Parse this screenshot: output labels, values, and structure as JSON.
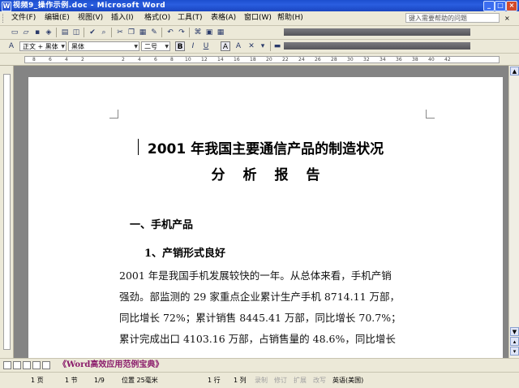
{
  "window": {
    "title": "视频9_操作示例.doc - Microsoft Word",
    "app_icon": "W"
  },
  "menu": {
    "items": [
      "文件(F)",
      "编辑(E)",
      "视图(V)",
      "插入(I)",
      "格式(O)",
      "工具(T)",
      "表格(A)",
      "窗口(W)",
      "帮助(H)"
    ],
    "help_placeholder": "键入需要帮助的问题"
  },
  "format_toolbar": {
    "style": "正文 + 黑体",
    "font": "黑体",
    "size": "二号",
    "bold": "B",
    "italic": "I",
    "underline": "U",
    "font_color_a": "A",
    "char_scale_a": "A"
  },
  "ruler": {
    "ticks": [
      "8",
      "6",
      "4",
      "2",
      "2",
      "4",
      "6",
      "8",
      "10",
      "12",
      "14",
      "16",
      "18",
      "20",
      "22",
      "24",
      "26",
      "28",
      "30",
      "32",
      "34",
      "36",
      "38",
      "40",
      "42"
    ]
  },
  "document": {
    "title_line1": "2001 年我国主要通信产品的制造状况",
    "title_line2": "分析报告",
    "section1": "一、手机产品",
    "subsection1": "1、产销形式良好",
    "paragraph_lines": [
      "2001 年是我国手机发展较快的一年。从总体来看，手机产销",
      "强劲。部监测的 29 家重点企业累计生产手机 8714.11 万部，",
      "同比增长 72%；累计销售 8445.41 万部，同比增长 70.7%；",
      "累计完成出口 4103.16 万部，占销售量的 48.6%，同比增长"
    ]
  },
  "banner": "《Word高效应用范例宝典》",
  "status": {
    "page": "1 页",
    "section": "1 节",
    "page_of": "1/9",
    "position": "位置 25毫米",
    "line": "1 行",
    "column": "1 列",
    "rec": "录制",
    "trk": "修订",
    "ext": "扩展",
    "ovr": "改写",
    "language": "英语(美国)"
  },
  "colors": {
    "title_bar": "#2a5ee0",
    "chrome": "#ece9d8",
    "banner_text": "#8a1a6a",
    "workspace": "#848484"
  }
}
